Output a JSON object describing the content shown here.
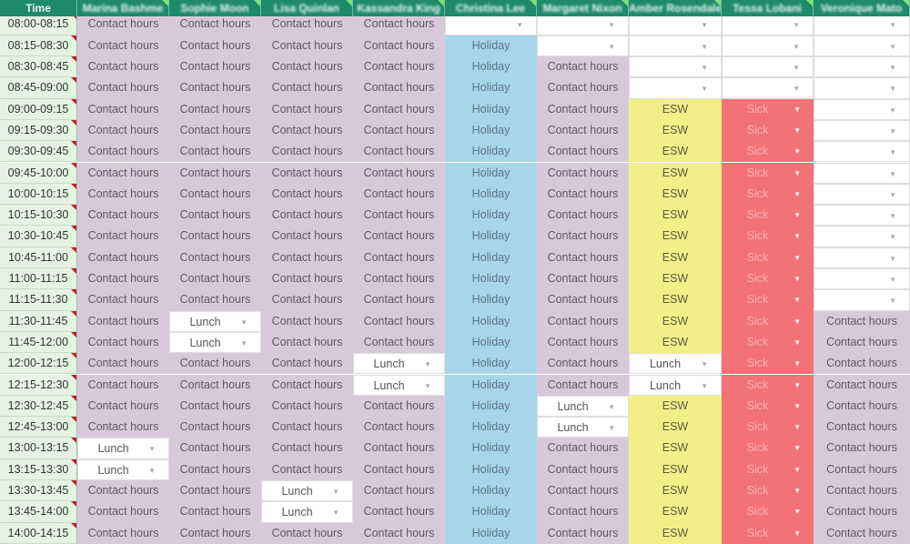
{
  "header": {
    "time_label": "Time",
    "columns": [
      "Marina Bashme",
      "Sophie Moon",
      "Lisa Quinlan",
      "Kassandra King",
      "Christina Lee",
      "Margaret Nixon",
      "Amber Rosendale",
      "Tessa Lobani",
      "Veronique Mato"
    ]
  },
  "times": [
    "08:00-08:15",
    "08:15-08:30",
    "08:30-08:45",
    "08:45-09:00",
    "09:00-09:15",
    "09:15-09:30",
    "09:30-09:45",
    "09:45-10:00",
    "10:00-10:15",
    "10:15-10:30",
    "10:30-10:45",
    "10:45-11:00",
    "11:00-11:15",
    "11:15-11:30",
    "11:30-11:45",
    "11:45-12:00",
    "12:00-12:15",
    "12:15-12:30",
    "12:30-12:45",
    "12:45-13:00",
    "13:00-13:15",
    "13:15-13:30",
    "13:30-13:45",
    "13:45-14:00",
    "14:00-14:15"
  ],
  "cells": [
    [
      "Contact hours",
      "Contact hours",
      "Contact hours",
      "Contact hours",
      "Contact hours",
      "Contact hours",
      "Contact hours",
      "Contact hours",
      "Contact hours",
      "Contact hours",
      "Contact hours",
      "Contact hours",
      "Contact hours",
      "Contact hours",
      "Contact hours",
      "Contact hours",
      "Contact hours",
      "Contact hours",
      "Contact hours",
      "Contact hours",
      "Lunch",
      "Lunch",
      "Contact hours",
      "Contact hours",
      "Contact hours"
    ],
    [
      "Contact hours",
      "Contact hours",
      "Contact hours",
      "Contact hours",
      "Contact hours",
      "Contact hours",
      "Contact hours",
      "Contact hours",
      "Contact hours",
      "Contact hours",
      "Contact hours",
      "Contact hours",
      "Contact hours",
      "Contact hours",
      "Lunch",
      "Lunch",
      "Contact hours",
      "Contact hours",
      "Contact hours",
      "Contact hours",
      "Contact hours",
      "Contact hours",
      "Contact hours",
      "Contact hours",
      "Contact hours"
    ],
    [
      "Contact hours",
      "Contact hours",
      "Contact hours",
      "Contact hours",
      "Contact hours",
      "Contact hours",
      "Contact hours",
      "Contact hours",
      "Contact hours",
      "Contact hours",
      "Contact hours",
      "Contact hours",
      "Contact hours",
      "Contact hours",
      "Contact hours",
      "Contact hours",
      "Contact hours",
      "Contact hours",
      "Contact hours",
      "Contact hours",
      "Contact hours",
      "Contact hours",
      "Lunch",
      "Lunch",
      "Contact hours"
    ],
    [
      "Contact hours",
      "Contact hours",
      "Contact hours",
      "Contact hours",
      "Contact hours",
      "Contact hours",
      "Contact hours",
      "Contact hours",
      "Contact hours",
      "Contact hours",
      "Contact hours",
      "Contact hours",
      "Contact hours",
      "Contact hours",
      "Contact hours",
      "Contact hours",
      "Lunch",
      "Lunch",
      "Contact hours",
      "Contact hours",
      "Contact hours",
      "Contact hours",
      "Contact hours",
      "Contact hours",
      "Contact hours"
    ],
    [
      "",
      "Holiday",
      "Holiday",
      "Holiday",
      "Holiday",
      "Holiday",
      "Holiday",
      "Holiday",
      "Holiday",
      "Holiday",
      "Holiday",
      "Holiday",
      "Holiday",
      "Holiday",
      "Holiday",
      "Holiday",
      "Holiday",
      "Holiday",
      "Holiday",
      "Holiday",
      "Holiday",
      "Holiday",
      "Holiday",
      "Holiday",
      "Holiday"
    ],
    [
      "",
      "",
      "Contact hours",
      "Contact hours",
      "Contact hours",
      "Contact hours",
      "Contact hours",
      "Contact hours",
      "Contact hours",
      "Contact hours",
      "Contact hours",
      "Contact hours",
      "Contact hours",
      "Contact hours",
      "Contact hours",
      "Contact hours",
      "Contact hours",
      "Contact hours",
      "Lunch",
      "Lunch",
      "Contact hours",
      "Contact hours",
      "Contact hours",
      "Contact hours",
      "Contact hours"
    ],
    [
      "",
      "",
      "",
      "",
      "ESW",
      "ESW",
      "ESW",
      "ESW",
      "ESW",
      "ESW",
      "ESW",
      "ESW",
      "ESW",
      "ESW",
      "ESW",
      "ESW",
      "Lunch",
      "Lunch",
      "ESW",
      "ESW",
      "ESW",
      "ESW",
      "ESW",
      "ESW",
      "ESW"
    ],
    [
      "",
      "",
      "",
      "",
      "Sick",
      "Sick",
      "Sick",
      "Sick",
      "Sick",
      "Sick",
      "Sick",
      "Sick",
      "Sick",
      "Sick",
      "Sick",
      "Sick",
      "Sick",
      "Sick",
      "Sick",
      "Sick",
      "Sick",
      "Sick",
      "Sick",
      "Sick",
      "Sick"
    ],
    [
      "",
      "",
      "",
      "",
      "",
      "",
      "",
      "",
      "",
      "",
      "",
      "",
      "",
      "",
      "Contact hours",
      "Contact hours",
      "Contact hours",
      "Contact hours",
      "Contact hours",
      "Contact hours",
      "Contact hours",
      "Contact hours",
      "Contact hours",
      "Contact hours",
      "Contact hours"
    ]
  ],
  "colors": {
    "header": "#1e8a6a",
    "contact": "#d8c9da",
    "holiday": "#a8d5ec",
    "esw": "#f3ef88",
    "sick": "#f37275",
    "time": "#e4f3e2"
  }
}
